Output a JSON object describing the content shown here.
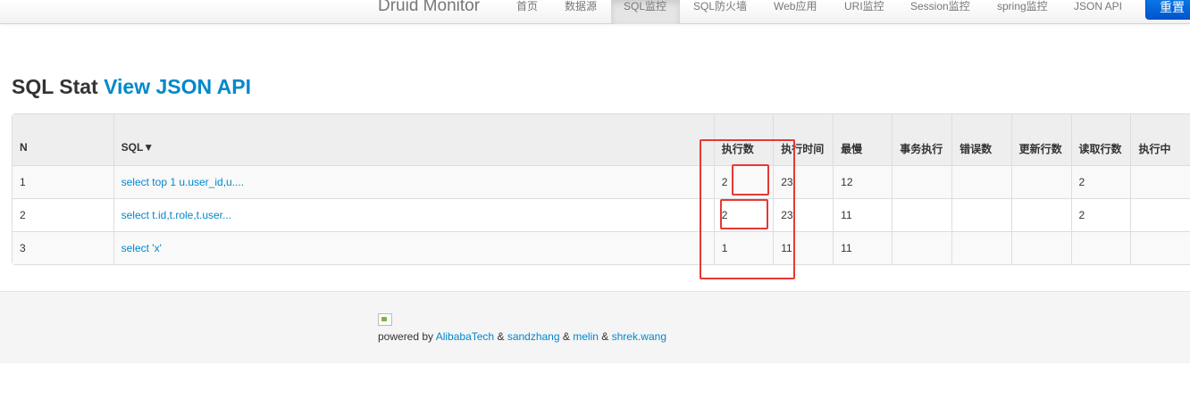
{
  "nav": {
    "brand": "Druid Monitor",
    "items": [
      "首页",
      "数据源",
      "SQL监控",
      "SQL防火墙",
      "Web应用",
      "URI监控",
      "Session监控",
      "spring监控",
      "JSON API"
    ],
    "active_index": 2,
    "reset_label": "重置"
  },
  "page": {
    "title_prefix": "SQL Stat",
    "title_link": "View JSON API"
  },
  "table": {
    "headers": [
      "N",
      "SQL▼",
      "执行数",
      "执行时间",
      "最慢",
      "事务执行",
      "错误数",
      "更新行数",
      "读取行数",
      "执行中"
    ],
    "rows": [
      {
        "n": "1",
        "sql": "select top 1 u.user_id,u....",
        "exec_count": "2",
        "exec_time": "23",
        "slowest": "12",
        "txn": "",
        "errors": "",
        "update_rows": "",
        "read_rows": "2",
        "running": ""
      },
      {
        "n": "2",
        "sql": "select t.id,t.role,t.user...",
        "exec_count": "2",
        "exec_time": "23",
        "slowest": "11",
        "txn": "",
        "errors": "",
        "update_rows": "",
        "read_rows": "2",
        "running": ""
      },
      {
        "n": "3",
        "sql": "select 'x'",
        "exec_count": "1",
        "exec_time": "11",
        "slowest": "11",
        "txn": "",
        "errors": "",
        "update_rows": "",
        "read_rows": "",
        "running": ""
      }
    ]
  },
  "footer": {
    "powered_by": "powered by",
    "amp": "&",
    "links": [
      "AlibabaTech",
      "sandzhang",
      "melin",
      "shrek.wang"
    ]
  },
  "colors": {
    "link": "#0088cc",
    "annotation": "#e53935",
    "button": "#0a6fe0"
  }
}
